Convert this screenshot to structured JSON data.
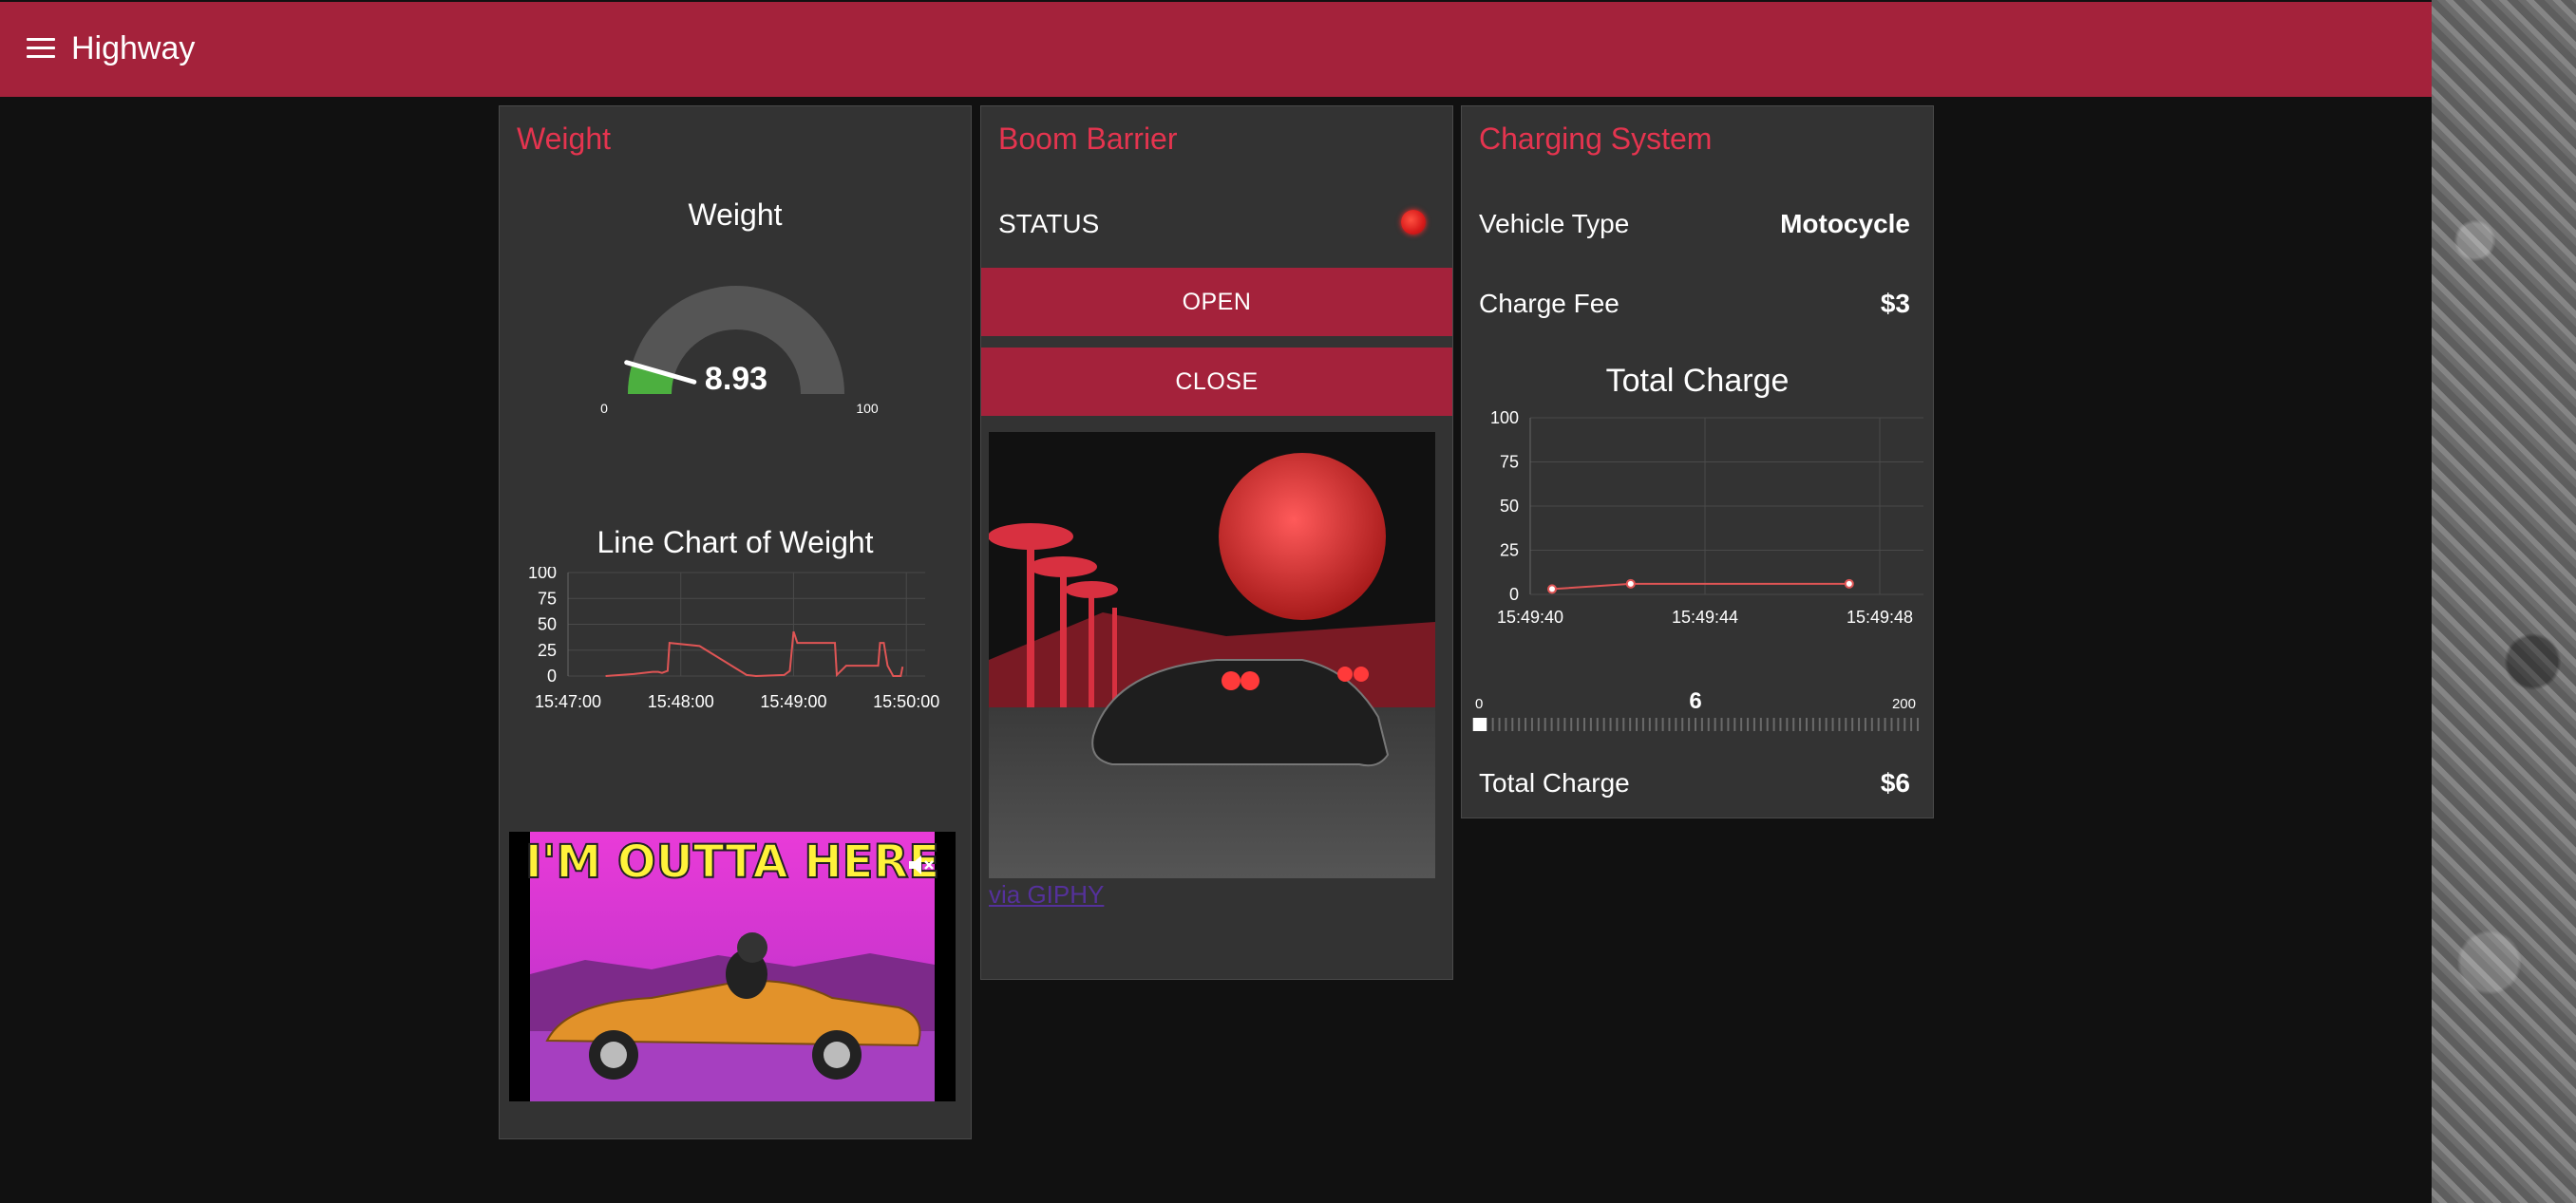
{
  "app": {
    "title": "Highway"
  },
  "colors": {
    "accent": "#a4223b",
    "title_red": "#e5344f",
    "chart_line": "#e05555",
    "gauge_fill": "#4caf3f",
    "status_on": "#e52222"
  },
  "weight_card": {
    "title": "Weight",
    "gauge": {
      "title": "Weight",
      "value": "8.93",
      "value_num": 8.93,
      "min": "0",
      "max": "100",
      "min_num": 0,
      "max_num": 100
    },
    "line_chart_title": "Line Chart of Weight",
    "gif": {
      "caption": "I'M OUTTA HERE",
      "mute_icon": "speaker-muted-icon"
    }
  },
  "barrier_card": {
    "title": "Boom Barrier",
    "status_label": "STATUS",
    "status_icon": "status-led-icon",
    "open_label": "OPEN",
    "close_label": "CLOSE",
    "via_link": "via GIPHY"
  },
  "charging_card": {
    "title": "Charging System",
    "vehicle_type_label": "Vehicle Type",
    "vehicle_type_value": "Motocycle",
    "charge_fee_label": "Charge Fee",
    "charge_fee_value": "$3",
    "chart_title": "Total Charge",
    "slider": {
      "min": "0",
      "max": "200",
      "value": "6",
      "value_num": 6,
      "min_num": 0,
      "max_num": 200
    },
    "total_label": "Total Charge",
    "total_value": "$6"
  },
  "chart_data": [
    {
      "type": "line",
      "title": "Line Chart of Weight",
      "x_ticks": [
        "15:47:00",
        "15:48:00",
        "15:49:00",
        "15:50:00"
      ],
      "y_ticks": [
        "0",
        "25",
        "50",
        "75",
        "100"
      ],
      "ylim": [
        0,
        100
      ],
      "xlim": [
        "15:47:00",
        "15:50:10"
      ],
      "grid": true,
      "series": [
        {
          "x": [
            "15:47:20",
            "15:47:35",
            "15:47:40",
            "15:47:45",
            "15:47:48",
            "15:47:50",
            "15:47:53",
            "15:47:54",
            "15:48:10",
            "15:48:35",
            "15:48:40",
            "15:48:55",
            "15:48:58",
            "15:49:00",
            "15:49:02",
            "15:49:03",
            "15:49:22",
            "15:49:23",
            "15:49:28",
            "15:49:45",
            "15:49:46",
            "15:49:48",
            "15:49:50",
            "15:49:53",
            "15:49:55",
            "15:49:57",
            "15:49:58"
          ],
          "y": [
            0,
            2,
            3,
            4,
            4,
            3,
            5,
            32,
            29,
            1,
            0,
            1,
            5,
            43,
            32,
            32,
            32,
            1,
            10,
            10,
            32,
            32,
            10,
            0,
            0,
            0,
            9
          ]
        }
      ]
    },
    {
      "type": "line",
      "title": "Total Charge",
      "x_ticks": [
        "15:49:40",
        "15:49:44",
        "15:49:48"
      ],
      "y_ticks": [
        "0",
        "25",
        "50",
        "75",
        "100"
      ],
      "ylim": [
        0,
        100
      ],
      "xlim": [
        "15:49:40",
        "15:49:49"
      ],
      "grid": true,
      "series": [
        {
          "x": [
            "15:49:40.5",
            "15:49:42.3",
            "15:49:47.3"
          ],
          "y": [
            3,
            6,
            6
          ]
        }
      ]
    }
  ]
}
